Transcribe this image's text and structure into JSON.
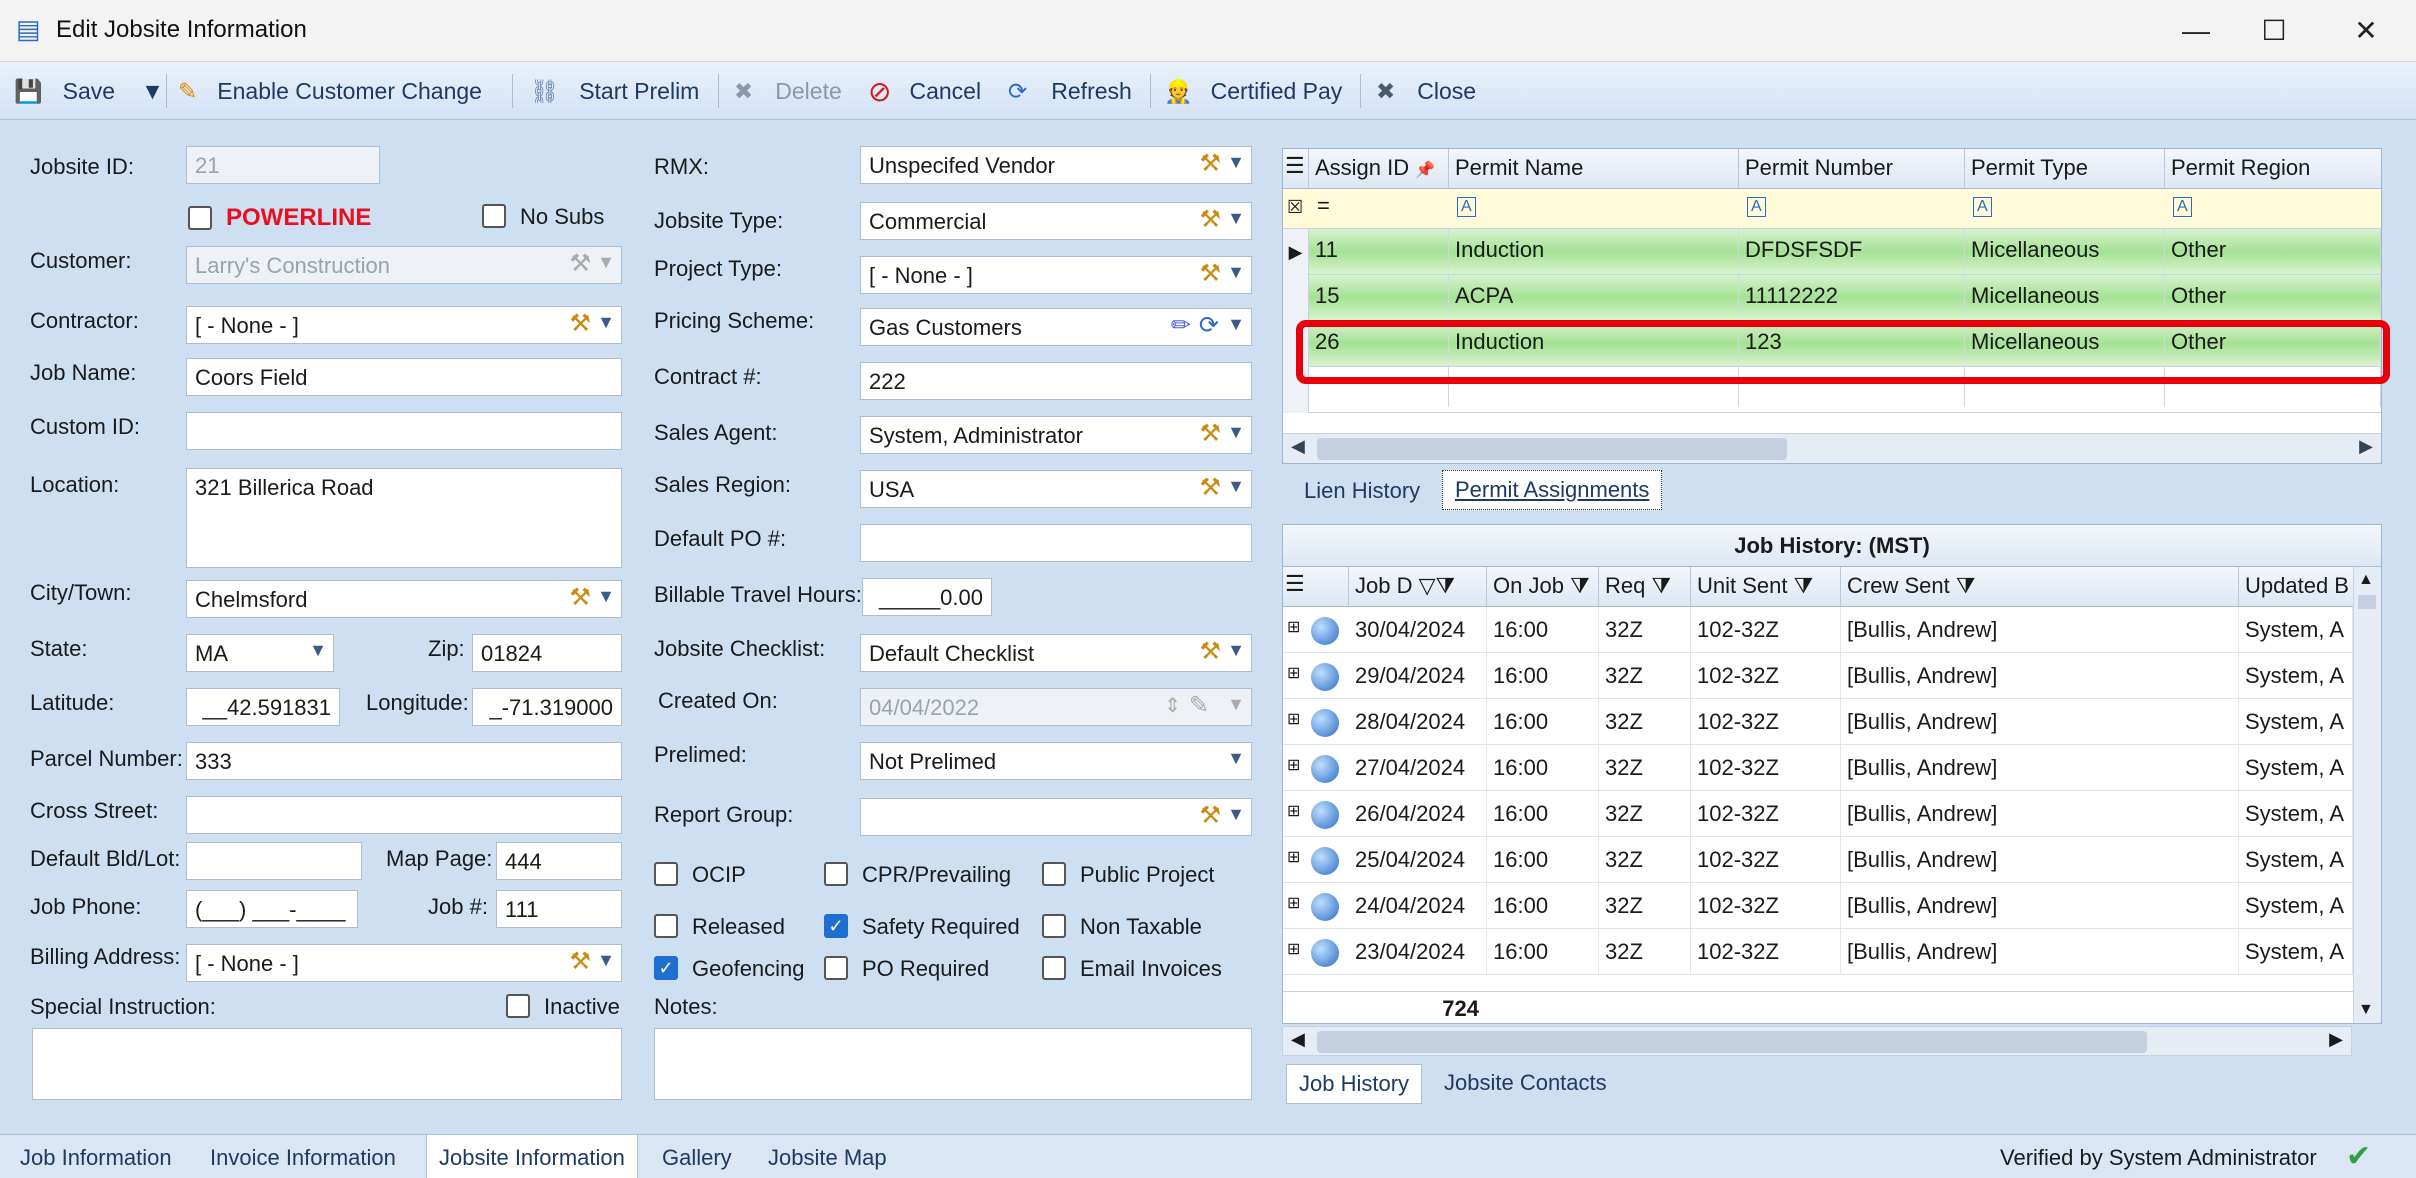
{
  "window": {
    "title": "Edit Jobsite Information",
    "minimize": "—",
    "maximize": "☐",
    "close": "✕"
  },
  "toolbar": {
    "save": "Save",
    "enable_customer_change": "Enable Customer Change",
    "start_prelim": "Start Prelim",
    "delete": "Delete",
    "cancel": "Cancel",
    "refresh": "Refresh",
    "certified_pay": "Certified Pay",
    "close": "Close"
  },
  "form": {
    "jobsite_id_label": "Jobsite ID:",
    "jobsite_id": "21",
    "powerline": "POWERLINE",
    "no_subs": "No Subs",
    "customer_label": "Customer:",
    "customer": "Larry's Construction",
    "contractor_label": "Contractor:",
    "contractor": "[ - None - ]",
    "job_name_label": "Job Name:",
    "job_name": "Coors Field",
    "custom_id_label": "Custom ID:",
    "custom_id": "",
    "location_label": "Location:",
    "location": "321 Billerica Road",
    "city_label": "City/Town:",
    "city": "Chelmsford",
    "state_label": "State:",
    "state": "MA",
    "zip_label": "Zip:",
    "zip": "01824",
    "latitude_label": "Latitude:",
    "latitude": "__42.591831",
    "longitude_label": "Longitude:",
    "longitude": "_-71.319000",
    "parcel_label": "Parcel Number:",
    "parcel": "333",
    "cross_street_label": "Cross Street:",
    "cross_street": "",
    "default_bld_label": "Default Bld/Lot:",
    "default_bld": "",
    "map_page_label": "Map Page:",
    "map_page": "444",
    "job_phone_label": "Job Phone:",
    "job_phone": "(___) ___-____",
    "job_no_label": "Job #:",
    "job_no": "111",
    "billing_label": "Billing Address:",
    "billing": "[ - None - ]",
    "special_label": "Special Instruction:",
    "inactive": "Inactive",
    "rmx_label": "RMX:",
    "rmx": "Unspecifed Vendor",
    "jobsite_type_label": "Jobsite Type:",
    "jobsite_type": "Commercial",
    "project_type_label": "Project Type:",
    "project_type": "[ - None - ]",
    "pricing_label": "Pricing Scheme:",
    "pricing": "Gas Customers",
    "contract_label": "Contract #:",
    "contract": "222",
    "sales_agent_label": "Sales Agent:",
    "sales_agent": "System, Administrator",
    "sales_region_label": "Sales Region:",
    "sales_region": "USA",
    "default_po_label": "Default PO #:",
    "default_po": "",
    "billable_label": "Billable Travel Hours:",
    "billable": "_____0.00",
    "checklist_label": "Jobsite Checklist:",
    "checklist": "Default Checklist",
    "created_label": "Created On:",
    "created": "04/04/2022",
    "prelimed_label": "Prelimed:",
    "prelimed": "Not Prelimed",
    "report_group_label": "Report Group:",
    "report_group": "",
    "ocip": "OCIP",
    "cpr": "CPR/Prevailing",
    "public_project": "Public Project",
    "released": "Released",
    "safety_required": "Safety Required",
    "non_taxable": "Non Taxable",
    "geofencing": "Geofencing",
    "po_required": "PO Required",
    "email_invoices": "Email Invoices",
    "notes_label": "Notes:"
  },
  "permits": {
    "headers": [
      "Assign ID",
      "Permit Name",
      "Permit Number",
      "Permit Type",
      "Permit Region"
    ],
    "rows": [
      [
        "11",
        "Induction",
        "DFDSFSDF",
        "Micellaneous",
        "Other"
      ],
      [
        "15",
        "ACPA",
        "11112222",
        "Micellaneous",
        "Other"
      ],
      [
        "26",
        "Induction",
        "123",
        "Micellaneous",
        "Other"
      ]
    ],
    "filter_eq": "=",
    "filter_a": "A"
  },
  "upper_tabs": [
    "Lien History",
    "Permit Assignments"
  ],
  "job_history": {
    "title": "Job History: (MST)",
    "headers": [
      "Job D",
      "On Job",
      "Req",
      "Unit Sent",
      "Crew Sent",
      "Updated B"
    ],
    "rows": [
      [
        "30/04/2024",
        "16:00",
        "32Z",
        "102-32Z",
        "[Bullis, Andrew]",
        "System, A"
      ],
      [
        "29/04/2024",
        "16:00",
        "32Z",
        "102-32Z",
        "[Bullis, Andrew]",
        "System, A"
      ],
      [
        "28/04/2024",
        "16:00",
        "32Z",
        "102-32Z",
        "[Bullis, Andrew]",
        "System, A"
      ],
      [
        "27/04/2024",
        "16:00",
        "32Z",
        "102-32Z",
        "[Bullis, Andrew]",
        "System, A"
      ],
      [
        "26/04/2024",
        "16:00",
        "32Z",
        "102-32Z",
        "[Bullis, Andrew]",
        "System, A"
      ],
      [
        "25/04/2024",
        "16:00",
        "32Z",
        "102-32Z",
        "[Bullis, Andrew]",
        "System, A"
      ],
      [
        "24/04/2024",
        "16:00",
        "32Z",
        "102-32Z",
        "[Bullis, Andrew]",
        "System, A"
      ],
      [
        "23/04/2024",
        "16:00",
        "32Z",
        "102-32Z",
        "[Bullis, Andrew]",
        "System, A"
      ]
    ],
    "count": "724"
  },
  "lower_tabs": [
    "Job History",
    "Jobsite Contacts"
  ],
  "bottom_tabs": [
    "Job Information",
    "Invoice Information",
    "Jobsite Information",
    "Gallery",
    "Jobsite Map"
  ],
  "status": "Verified by System Administrator",
  "colors": {
    "highlight": "#e8000b",
    "powerline": "#e8101e",
    "selected_row": "#a4e294"
  }
}
